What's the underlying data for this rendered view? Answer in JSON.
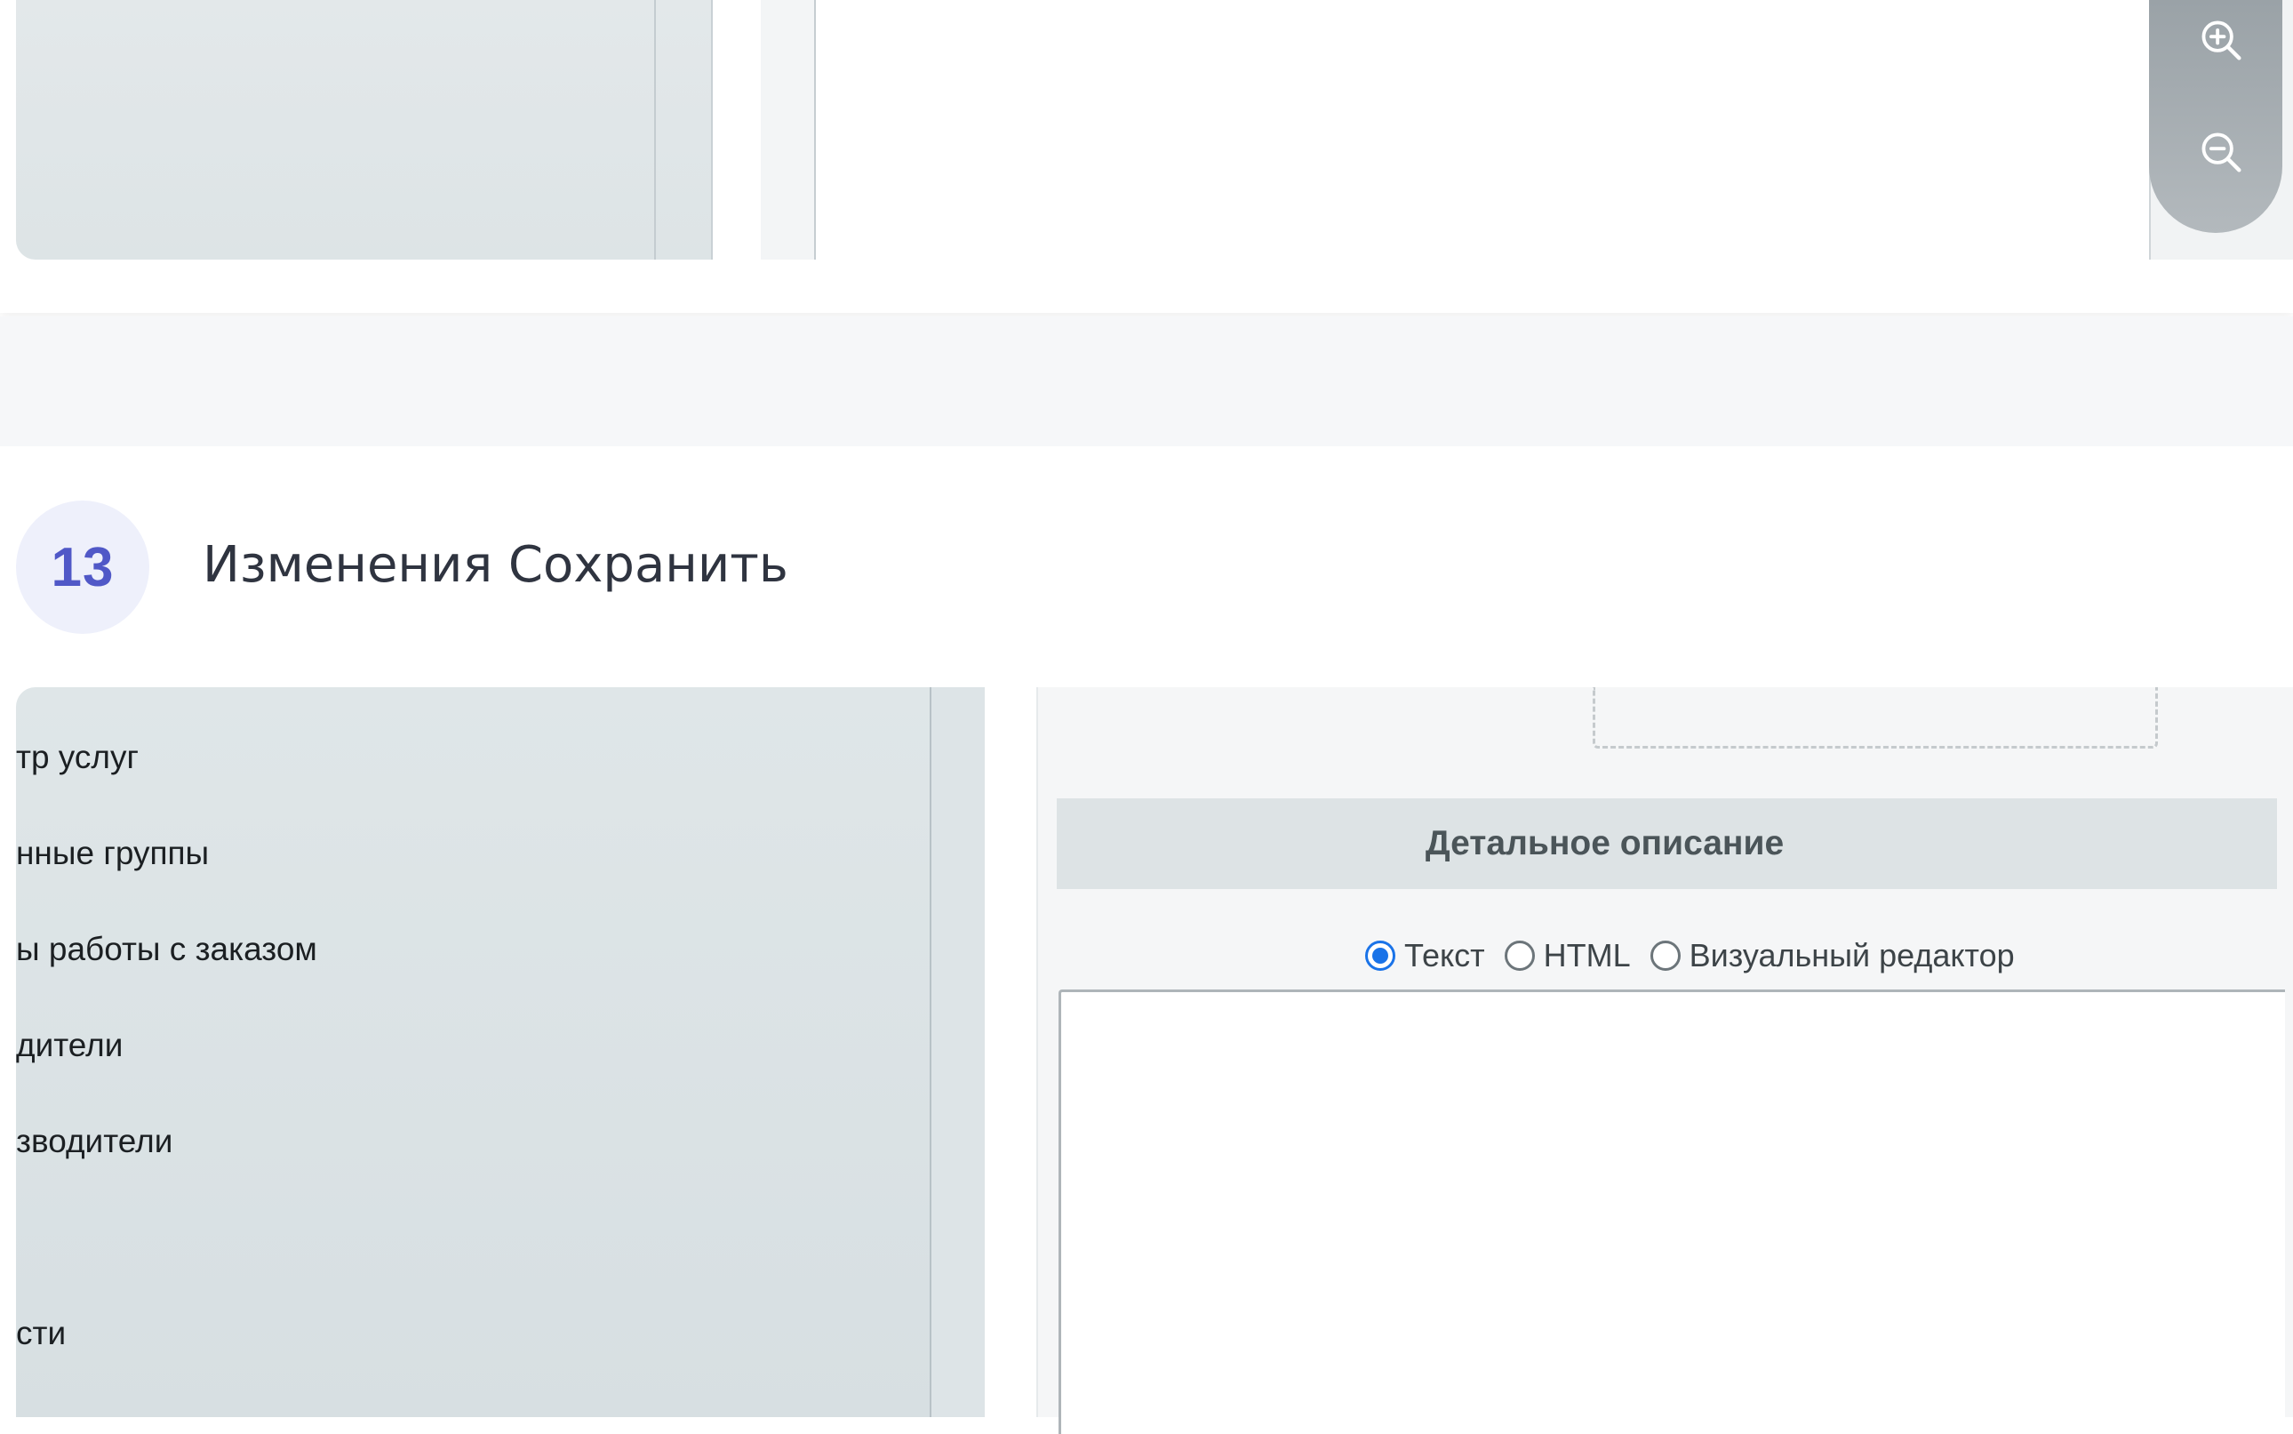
{
  "top_zoom": {
    "zoom_in_icon": "zoom-in-icon",
    "zoom_out_icon": "zoom-out-icon"
  },
  "step": {
    "number": "13",
    "title": "Изменения Сохранить"
  },
  "sidebar": {
    "items": [
      {
        "label": "тр услуг"
      },
      {
        "label": "нные группы"
      },
      {
        "label": "ы работы с заказом"
      },
      {
        "label": "дители"
      },
      {
        "label": "зводители"
      },
      {
        "label": "сти"
      }
    ]
  },
  "detail": {
    "header": "Детальное описание",
    "radio_options": [
      {
        "label": "Текст",
        "checked": true
      },
      {
        "label": "HTML",
        "checked": false
      },
      {
        "label": "Визуальный редактор",
        "checked": false
      }
    ]
  },
  "colors": {
    "accent": "#5058c7",
    "radio_checked": "#1a73e8"
  }
}
